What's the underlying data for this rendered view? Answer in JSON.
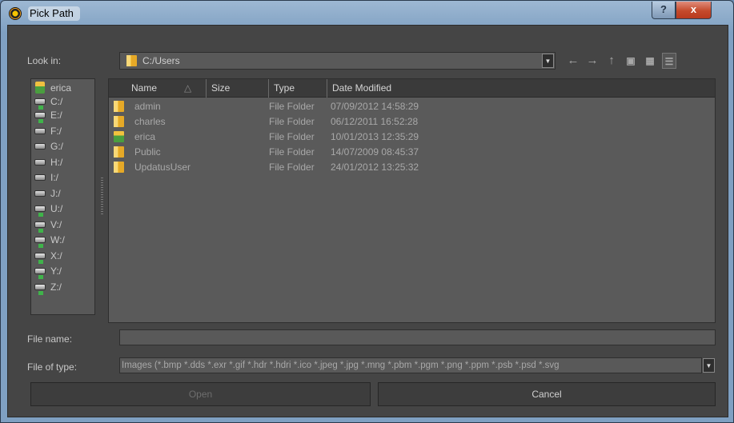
{
  "window": {
    "title": "Pick Path"
  },
  "titlebar": {
    "help_label": "?",
    "close_label": "x"
  },
  "lookin": {
    "label": "Look in:",
    "path": "C:/Users"
  },
  "sidebar": {
    "items": [
      {
        "label": "erica",
        "icon": "user-icon"
      },
      {
        "label": "C:/",
        "icon": "network-drive-icon"
      },
      {
        "label": "E:/",
        "icon": "network-drive-icon"
      },
      {
        "label": "F:/",
        "icon": "drive-icon"
      },
      {
        "label": "G:/",
        "icon": "drive-icon"
      },
      {
        "label": "H:/",
        "icon": "drive-icon"
      },
      {
        "label": "I:/",
        "icon": "drive-icon"
      },
      {
        "label": "J:/",
        "icon": "drive-icon"
      },
      {
        "label": "U:/",
        "icon": "network-drive-icon"
      },
      {
        "label": "V:/",
        "icon": "network-drive-icon"
      },
      {
        "label": "W:/",
        "icon": "network-drive-icon"
      },
      {
        "label": "X:/",
        "icon": "network-drive-icon"
      },
      {
        "label": "Y:/",
        "icon": "network-drive-icon"
      },
      {
        "label": "Z:/",
        "icon": "network-drive-icon"
      }
    ]
  },
  "list": {
    "columns": {
      "name": "Name",
      "size": "Size",
      "type": "Type",
      "date": "Date Modified"
    },
    "sort_indicator": "△",
    "rows": [
      {
        "name": "admin",
        "size": "",
        "type": "File Folder",
        "date": "07/09/2012 14:58:29",
        "icon": "folder-icon"
      },
      {
        "name": "charles",
        "size": "",
        "type": "File Folder",
        "date": "06/12/2011 16:52:28",
        "icon": "folder-icon"
      },
      {
        "name": "erica",
        "size": "",
        "type": "File Folder",
        "date": "10/01/2013 12:35:29",
        "icon": "user-folder-icon"
      },
      {
        "name": "Public",
        "size": "",
        "type": "File Folder",
        "date": "14/07/2009 08:45:37",
        "icon": "folder-icon"
      },
      {
        "name": "UpdatusUser",
        "size": "",
        "type": "File Folder",
        "date": "24/01/2012 13:25:32",
        "icon": "folder-icon"
      }
    ]
  },
  "filename": {
    "label": "File name:",
    "value": ""
  },
  "filetype": {
    "label": "File of type:",
    "value": "Images (*.bmp *.dds *.exr *.gif *.hdr *.hdri *.ico *.jpeg *.jpg *.mng *.pbm *.pgm *.png *.ppm *.psb *.psd *.svg"
  },
  "buttons": {
    "open": "Open",
    "cancel": "Cancel"
  }
}
